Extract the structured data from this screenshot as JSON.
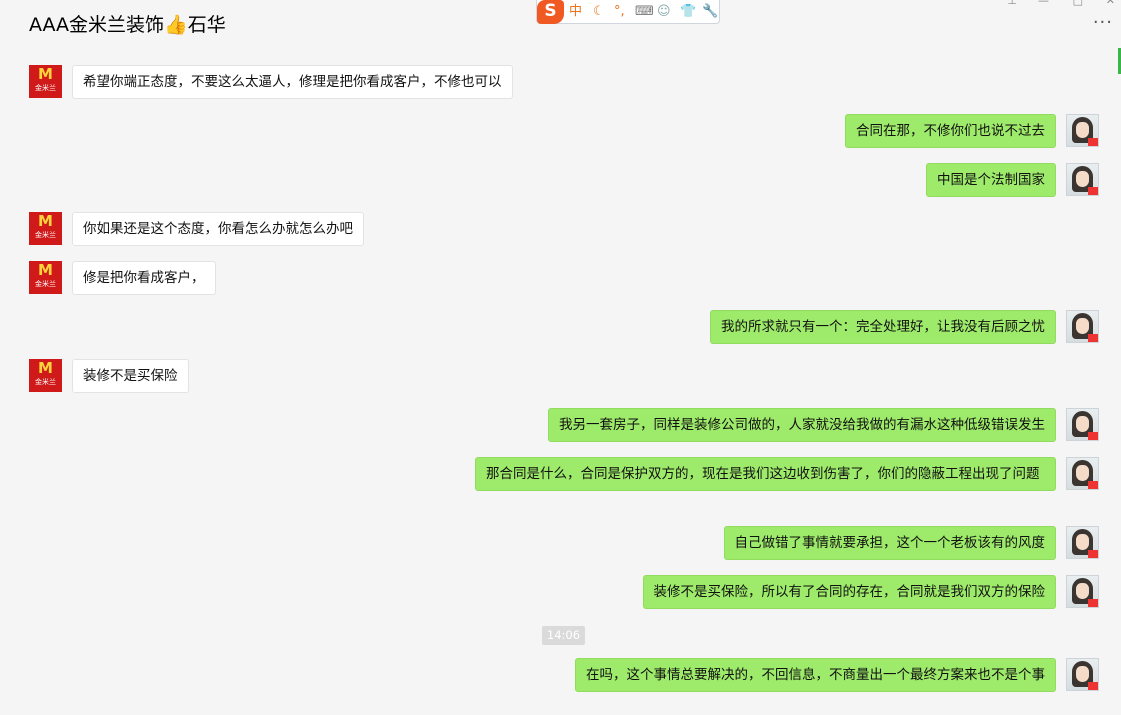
{
  "window": {
    "title": "AAA金米兰装饰👍石华",
    "more_label": "···",
    "controls": [
      "pin-icon",
      "minimize-icon",
      "maximize-icon",
      "close-icon"
    ]
  },
  "ime_toolbar": {
    "logo": "S",
    "mode": "中",
    "icons": [
      "moon-icon",
      "punctuation-icon",
      "keyboard-icon",
      "user-icon",
      "skin-icon",
      "wrench-icon"
    ]
  },
  "contacts": {
    "brand_avatar": {
      "letter": "M",
      "name": "金米兰",
      "bg_color": "#d01a1a"
    },
    "user_avatar": {
      "icon": "woman-portrait-icon"
    }
  },
  "messages": [
    {
      "side": "left",
      "text": "希望你端正态度，不要这么太逼人，修理是把你看成客户，不修也可以"
    },
    {
      "side": "right",
      "text": "合同在那，不修你们也说不过去"
    },
    {
      "side": "right",
      "text": "中国是个法制国家"
    },
    {
      "side": "left",
      "text": "你如果还是这个态度，你看怎么办就怎么办吧"
    },
    {
      "side": "left",
      "text": "修是把你看成客户，"
    },
    {
      "side": "right",
      "text": "我的所求就只有一个：完全处理好，让我没有后顾之忧"
    },
    {
      "side": "left",
      "text": "装修不是买保险"
    },
    {
      "side": "right",
      "text": "我另一套房子，同样是装修公司做的，人家就没给我做的有漏水这种低级错误发生"
    },
    {
      "side": "right",
      "text": "那合同是什么，合同是保护双方的，现在是我们这边收到伤害了，你们的隐蔽工程出现了问题"
    },
    {
      "side": "right",
      "text": "自己做错了事情就要承担，这个一个老板该有的风度"
    },
    {
      "side": "right",
      "text": "装修不是买保险，所以有了合同的存在，合同就是我们双方的保险"
    },
    {
      "side": "right",
      "text": "在吗，这个事情总要解决的，不回信息，不商量出一个最终方案来也不是个事"
    }
  ],
  "timestamp": "14:06",
  "colors": {
    "background": "#f5f5f5",
    "sent_bubble": "#9eea6a",
    "received_bubble": "#ffffff",
    "accent": "#39b54a"
  }
}
